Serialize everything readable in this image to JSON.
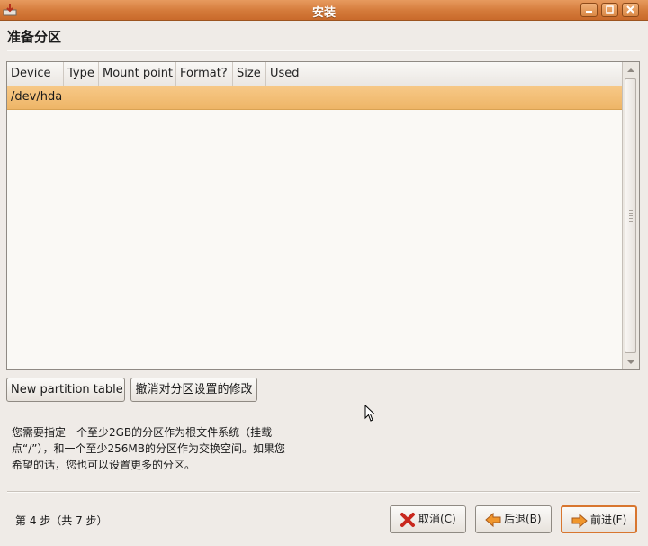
{
  "window": {
    "title": "安装",
    "buttons": [
      "minimize",
      "maximize",
      "close"
    ]
  },
  "page": {
    "title": "准备分区"
  },
  "table": {
    "columns": [
      "Device",
      "Type",
      "Mount point",
      "Format?",
      "Size",
      "Used"
    ],
    "rows": [
      {
        "device": "/dev/hda",
        "type": "",
        "mount_point": "",
        "format": "",
        "size": "",
        "used": "",
        "selected": true
      }
    ]
  },
  "actions": {
    "new_partition_table": "New partition table",
    "undo_changes": "撤消对分区设置的修改"
  },
  "info_text": "您需要指定一个至少2GB的分区作为根文件系统（挂载\n点“/”），和一个至少256MB的分区作为交换空间。如果您\n希望的话，您也可以设置更多的分区。",
  "footer": {
    "step": "第 4 步（共 7 步）",
    "cancel": "取消(C)",
    "back": "后退(B)",
    "forward": "前进(F)"
  },
  "colors": {
    "titlebar": "#d47a3a",
    "selected_row": "#f0b96c",
    "background": "#efebe7"
  },
  "icons": {
    "app": "installer-icon",
    "cancel": "red-x-icon",
    "back": "left-arrow-icon",
    "forward": "right-arrow-icon"
  }
}
